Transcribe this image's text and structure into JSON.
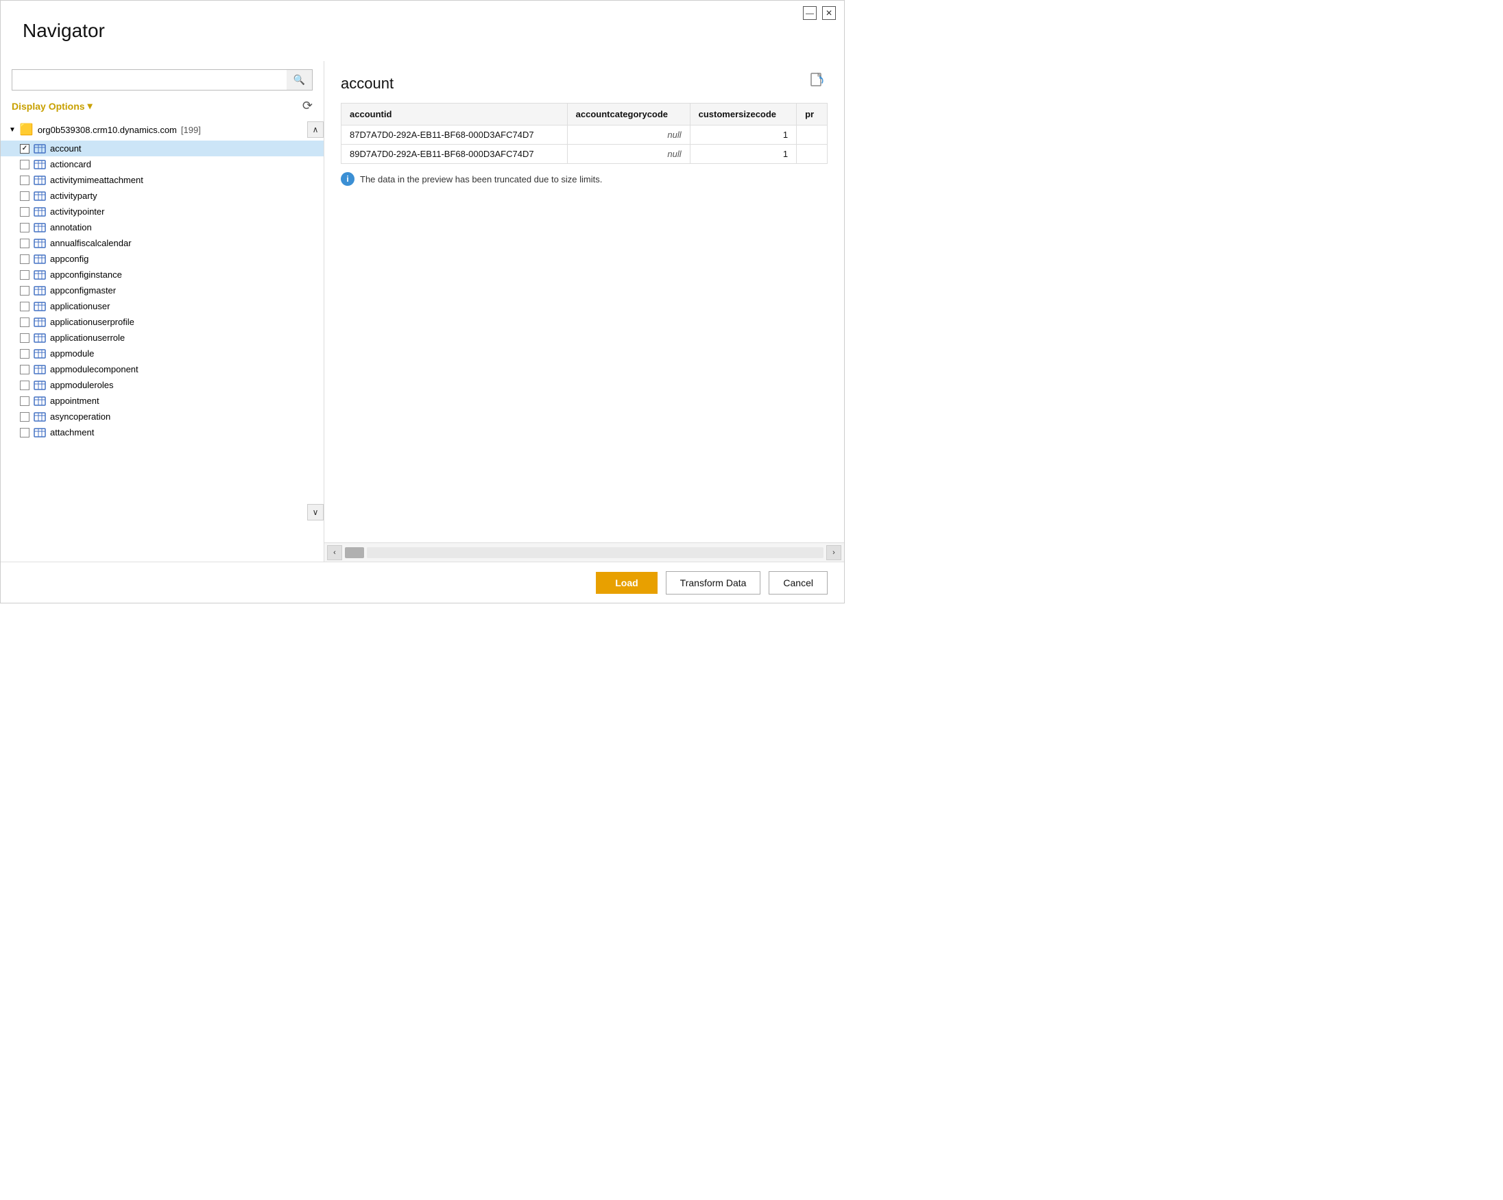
{
  "titlebar": {
    "minimize_label": "🗖",
    "close_label": "✕"
  },
  "main_title": "Navigator",
  "search": {
    "placeholder": "",
    "value": "",
    "icon": "🔍"
  },
  "display_options": {
    "label": "Display Options",
    "chevron": "▾"
  },
  "refresh_icon": "⟳",
  "tree": {
    "root": {
      "label": "org0b539308.crm10.dynamics.com",
      "count": "[199]"
    },
    "items": [
      {
        "name": "account",
        "checked": true
      },
      {
        "name": "actioncard",
        "checked": false
      },
      {
        "name": "activitymimeattachment",
        "checked": false
      },
      {
        "name": "activityparty",
        "checked": false
      },
      {
        "name": "activitypointer",
        "checked": false
      },
      {
        "name": "annotation",
        "checked": false
      },
      {
        "name": "annualfiscalcalendar",
        "checked": false
      },
      {
        "name": "appconfig",
        "checked": false
      },
      {
        "name": "appconfiginstance",
        "checked": false
      },
      {
        "name": "appconfigmaster",
        "checked": false
      },
      {
        "name": "applicationuser",
        "checked": false
      },
      {
        "name": "applicationuserprofile",
        "checked": false
      },
      {
        "name": "applicationuserrole",
        "checked": false
      },
      {
        "name": "appmodule",
        "checked": false
      },
      {
        "name": "appmodulecomponent",
        "checked": false
      },
      {
        "name": "appmoduleroles",
        "checked": false
      },
      {
        "name": "appointment",
        "checked": false
      },
      {
        "name": "asyncoperation",
        "checked": false
      },
      {
        "name": "attachment",
        "checked": false
      }
    ]
  },
  "preview": {
    "title": "account",
    "columns": [
      "accountid",
      "accountcategorycode",
      "customersizecode",
      "pr"
    ],
    "rows": [
      {
        "accountid": "87D7A7D0-292A-EB11-BF68-000D3AFC74D7",
        "accountcategorycode": "null",
        "customersizecode": "1",
        "pr": ""
      },
      {
        "accountid": "89D7A7D0-292A-EB11-BF68-000D3AFC74D7",
        "accountcategorycode": "null",
        "customersizecode": "1",
        "pr": ""
      }
    ],
    "truncate_notice": "The data in the preview has been truncated due to size limits."
  },
  "buttons": {
    "load": "Load",
    "transform": "Transform Data",
    "cancel": "Cancel"
  },
  "scroll_up": "∧",
  "scroll_down": "∨",
  "scroll_left": "‹",
  "scroll_right": "›"
}
